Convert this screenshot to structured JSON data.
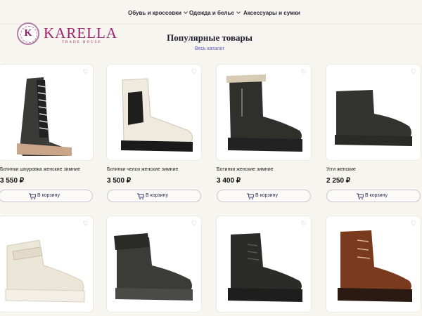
{
  "nav": {
    "items": [
      "Обувь и кроссовки",
      "Одежда и белье",
      "Аксессуары и сумки"
    ]
  },
  "logo": {
    "name": "KARELLA",
    "sub": "TRADE HOUSE",
    "mark": "K"
  },
  "section": {
    "title": "Популярные товары",
    "catalog_link": "Весь каталог"
  },
  "products": [
    {
      "name": "Ботинки шнуровка женские зимние",
      "price": "3 550 ₽",
      "button": "В корзину",
      "icon": "lace-up-tall-boot"
    },
    {
      "name": "Ботинки челси женские зимние",
      "price": "3 500 ₽",
      "button": "В корзину",
      "icon": "chelsea-boot"
    },
    {
      "name": "Ботинки женские зимние",
      "price": "3 400 ₽",
      "button": "В корзину",
      "icon": "zip-boot"
    },
    {
      "name": "Угги женские",
      "price": "2 250 ₽",
      "button": "В корзину",
      "icon": "ugg-boot"
    },
    {
      "icon": "velcro-sneaker"
    },
    {
      "icon": "fur-sport-boot"
    },
    {
      "icon": "black-lace-boot"
    },
    {
      "icon": "brown-lace-boot"
    }
  ],
  "colors": {
    "accent": "#5a54c8",
    "brand": "#a0226f",
    "background": "#f7f5ef"
  }
}
